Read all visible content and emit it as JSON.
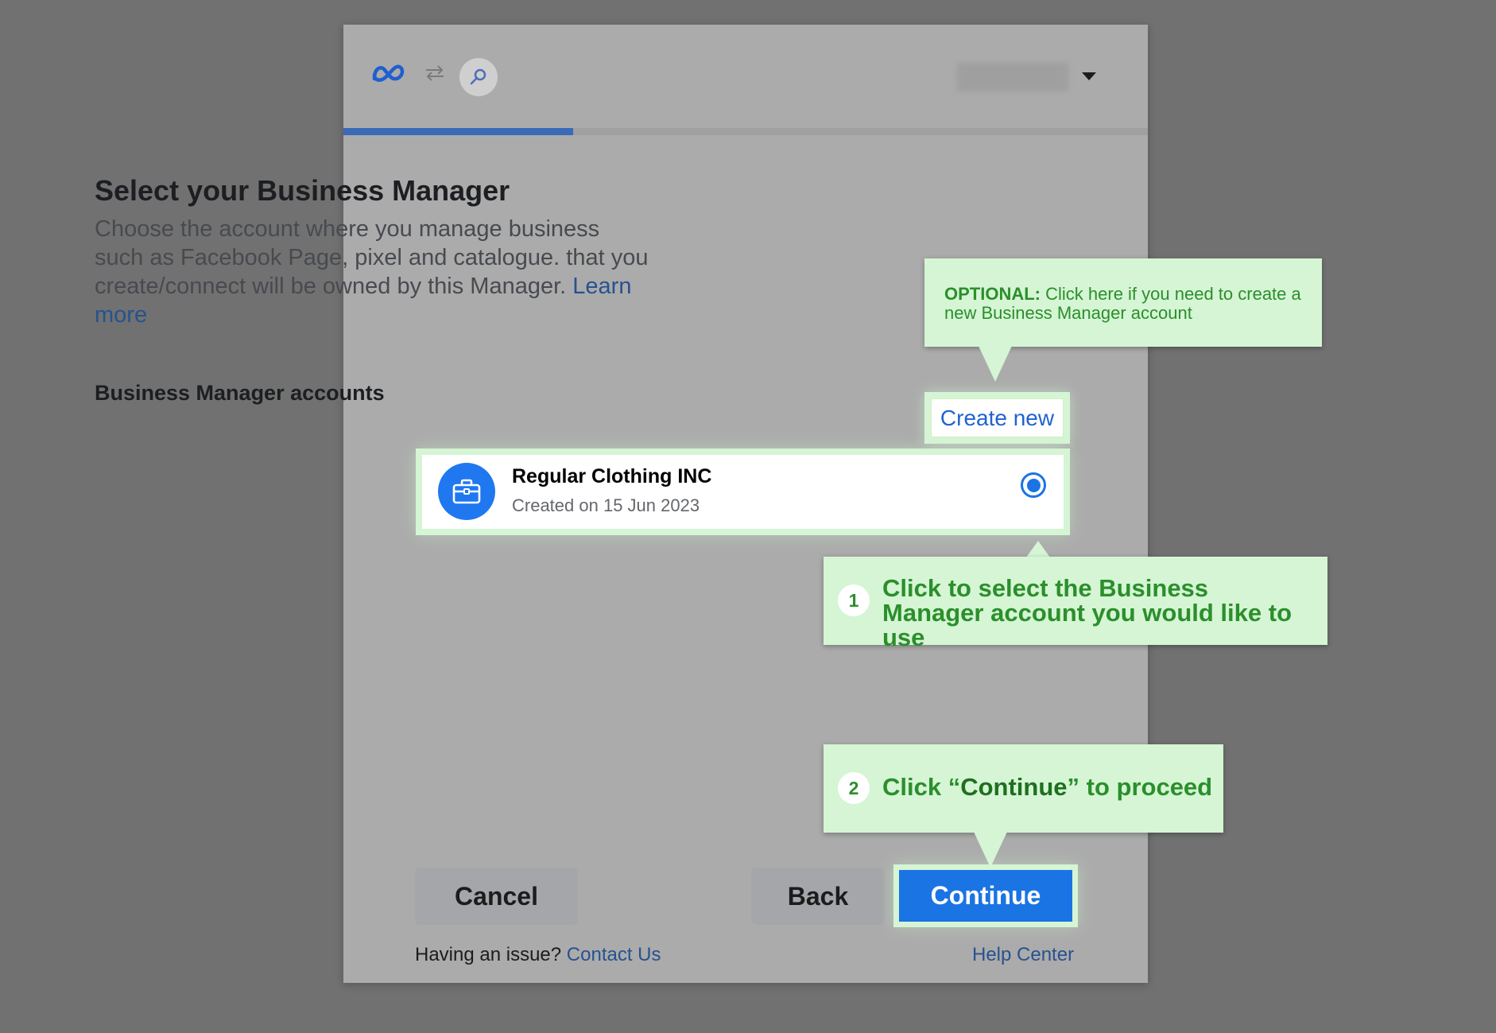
{
  "header": {
    "logo_icon": "meta-logo-icon",
    "connect_icon": "swap-arrows-icon",
    "app_icon": "app-link-icon",
    "account_caret_icon": "caret-down-icon",
    "progress_fraction": 0.286
  },
  "main": {
    "title": "Select your Business Manager",
    "description": "Choose the account where you manage business such as Facebook Page, pixel and catalogue. that you create/connect will be owned by this Manager.",
    "learn_more": "Learn more",
    "accounts_label": "Business Manager accounts",
    "create_new": "Create new",
    "accounts": [
      {
        "name": "Regular Clothing INC",
        "created": "Created on 15 Jun 2023",
        "icon": "briefcase-icon",
        "selected": true
      }
    ]
  },
  "footer": {
    "cancel": "Cancel",
    "back": "Back",
    "continue": "Continue",
    "issue_text": "Having an issue?",
    "contact_us": "Contact Us",
    "help_center": "Help Center"
  },
  "annotations": {
    "optional_bold": "OPTIONAL:",
    "optional_text": "Click here if you need to create a new Business Manager account",
    "step1_number": "1",
    "step1_text": "Click to select the Business Manager account you would like to use",
    "step2_number": "2",
    "step2_prefix": "Click “",
    "step2_bold": "Continue",
    "step2_suffix": "” to proceed"
  },
  "colors": {
    "primary_blue": "#1b74e4",
    "link_blue": "#27528f",
    "callout_bg": "#d5f5d5",
    "callout_text": "#2b8f2b",
    "overlay_bg": "#717171"
  }
}
